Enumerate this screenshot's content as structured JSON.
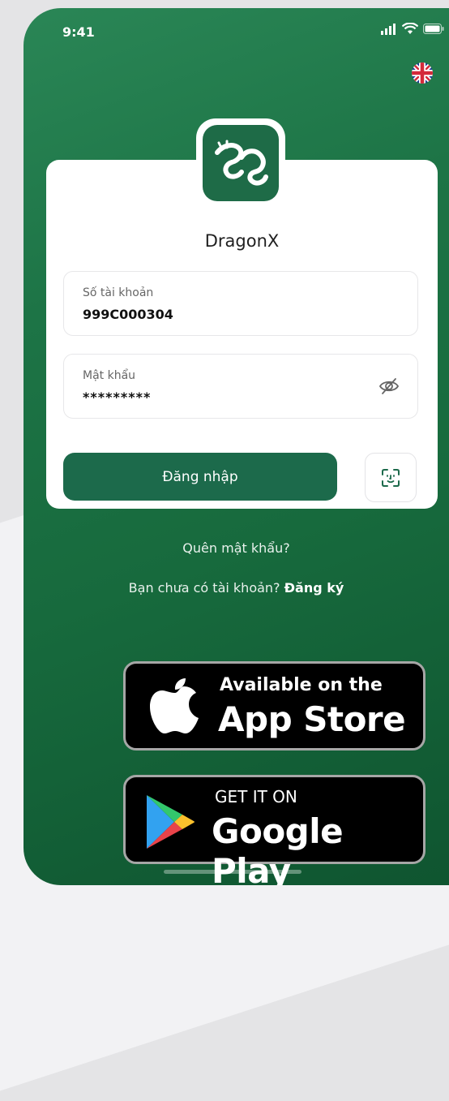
{
  "status_bar": {
    "time": "9:41"
  },
  "app": {
    "name": "DragonX"
  },
  "form": {
    "account_label": "Số tài khoản",
    "account_value": "999C000304",
    "password_label": "Mật khẩu",
    "password_value": "*********",
    "login_label": "Đăng nhập"
  },
  "links": {
    "forgot_password": "Quên mật khẩu?",
    "no_account": "Bạn chưa có tài khoản?",
    "register": "Đăng ký"
  },
  "badges": {
    "appstore_small": "Available on the",
    "appstore_big": "App Store",
    "googleplay_small": "GET IT ON",
    "googleplay_big": "Google Play"
  },
  "icons": {
    "language": "uk-flag-icon",
    "logo": "dragon-logo-icon",
    "toggle_password": "eye-off-icon",
    "face_id": "face-id-icon",
    "apple": "apple-icon",
    "google_play": "google-play-icon"
  },
  "colors": {
    "background_green": "#1d7446",
    "button_green": "#1c6a4b",
    "logo_green": "#1e6b47",
    "card": "#ffffff"
  }
}
